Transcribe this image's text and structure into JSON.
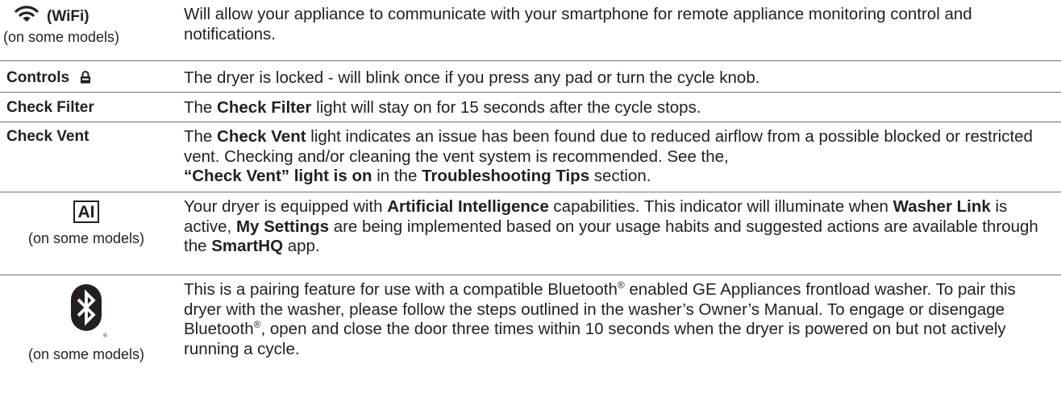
{
  "rows": [
    {
      "label": "(WiFi)",
      "sublabel": "(on some models)",
      "icon": "wifi-icon",
      "description": "Will allow your appliance to communicate with your smartphone for remote appliance monitoring control and notifications."
    },
    {
      "label": "Controls",
      "icon": "lock-icon",
      "description": "The dryer is locked - will blink once if you press any pad or turn the cycle knob."
    },
    {
      "label": "Check Filter",
      "description": {
        "t1": "The ",
        "b1": "Check Filter",
        "t2": " light will stay on for 15 seconds after the cycle stops."
      }
    },
    {
      "label": "Check Vent",
      "description": {
        "t1": "The ",
        "b1": "Check Vent",
        "t2": " light indicates an issue has been found due to reduced airflow from a possible blocked or restricted vent. Checking and/or cleaning the vent system is recommended. See the,",
        "b2": "“Check Vent” light is on",
        "t3": " in the ",
        "b3": "Troubleshooting Tips",
        "t4": " section."
      }
    },
    {
      "icon_text": "AI",
      "icon": "ai-icon",
      "sublabel": "(on some models)",
      "description": {
        "t1": "Your dryer is equipped with ",
        "b1": "Artificial Intelligence",
        "t2": " capabilities. This indicator will illuminate when ",
        "b2": "Washer Link",
        "t3": " is active, ",
        "b3": "My Settings",
        "t4": " are being implemented based on your usage habits and suggested actions are available through the ",
        "b4": "SmartHQ",
        "t5": " app."
      }
    },
    {
      "icon": "bluetooth-icon",
      "icon_mark": "®",
      "sublabel": "(on some models)",
      "description": {
        "t1": "This is a pairing feature for use with a compatible Bluetooth",
        "sup1": "®",
        "t2": " enabled GE Appliances frontload washer. To pair this dryer with the washer, please follow the steps outlined in the washer’s Owner’s Manual. To engage or disengage Bluetooth",
        "sup2": "®",
        "t3": ", open and close the door three times within 10 seconds when the dryer is powered on but not actively running a cycle."
      }
    }
  ]
}
